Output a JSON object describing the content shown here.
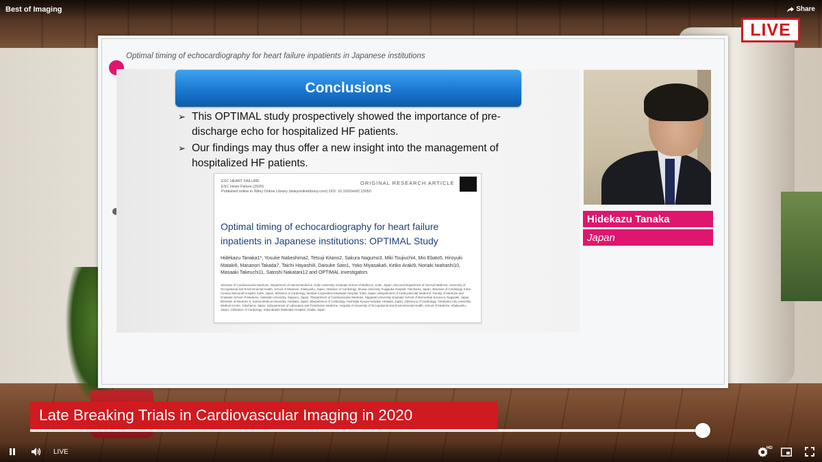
{
  "channel": {
    "title": "Best of Imaging",
    "share_label": "Share"
  },
  "live_badge": "LIVE",
  "slide": {
    "header": "Optimal timing of echocardiography for heart failure inpatients in Japanese institutions",
    "heading": "Conclusions",
    "bullets": [
      "This OPTIMAL study prospectively showed the importance of pre-discharge echo for hospitalized HF patients.",
      "Our findings may thus offer a new insight into the management of hospitalized HF patients."
    ],
    "bullet_mark": "➢",
    "paper": {
      "journal_lines": [
        "ESC HEART FAILURE",
        "ESC Heart Failure (2020)",
        "Published online in Wiley Online Library (wileyonlinelibrary.com) DOI: 10.1002/ehf2.13050"
      ],
      "article_type": "ORIGINAL RESEARCH ARTICLE",
      "title": "Optimal timing of echocardiography for heart failure inpatients in Japanese institutions: OPTIMAL Study",
      "authors": "Hidekazu Tanaka1*, Yosuke Nabeshima2, Tetsuji Kitano2, Sakura Nagumo3, Miki Tsujiuchi4, Mio Ebato5, Hiroyuki Mataki6, Masanori Takada7, Taichi Hayashi8, Daisuke Sato1, Yoko Miyasaka6, Keiko Araki9, Noriaki Iwahashi10, Masaaki Takeuchi11, Satoshi Nakatani12 and OPTIMAL investigators",
      "affiliations": "1Division of Cardiovascular Medicine, Department of Internal Medicine, Kobe University Graduate School of Medicine, Kobe, Japan; 2Second Department of Internal Medicine, University of Occupational and Environmental Health, School of Medicine, Kitakyushu, Japan; 3Division of Cardiology, Showa University Fujigaoka Hospital, Yokohama, Japan; 4Division of Cardiology, Kobe Century Memorial Hospital, Kobe, Japan; 5Division of Cardiology, Medical Corporation Kawasaki Hospital, Kobe, Japan; 6Department of Cardiovascular Medicine, Faculty of Medicine and Graduate School of Medicine, Hokkaido University, Sapporo, Japan; 7Department of Cardiovascular Medicine, Nagasaki University Graduate School of Biomedical Sciences, Nagasaki, Japan; 8Division of Medicine II, Kansai Medical University, Hirakata, Japan; 9Department of Cardiology, Hoshizaki Kyouai Hospital, Hirakata, Japan; 10Division of Cardiology, Yokohama City University Medical Center, Yokohama, Japan; 11Department of Laboratory and Transfusion Medicine, Hospital of University of Occupational and Environmental Health, School of Medicine, Kitakyushu, Japan; 12Division of Cardiology, Sakurabashi Watanabe Hospital, Osaka, Japan"
    }
  },
  "speaker": {
    "name": "Hidekazu Tanaka",
    "country": "Japan"
  },
  "lower_third": "Late Breaking Trials in Cardiovascular Imaging in 2020",
  "player": {
    "live_label": "LIVE",
    "hd_badge": "HD",
    "progress": 0.99,
    "icons": [
      "pause-icon",
      "volume-icon",
      "settings-icon",
      "pip-icon",
      "fullscreen-icon",
      "share-icon"
    ]
  },
  "colors": {
    "brand_pink": "#e0156e",
    "live_red": "#d0141a",
    "lower_third_red": "#d01a20",
    "conclusions_blue": "#1a78d2"
  }
}
